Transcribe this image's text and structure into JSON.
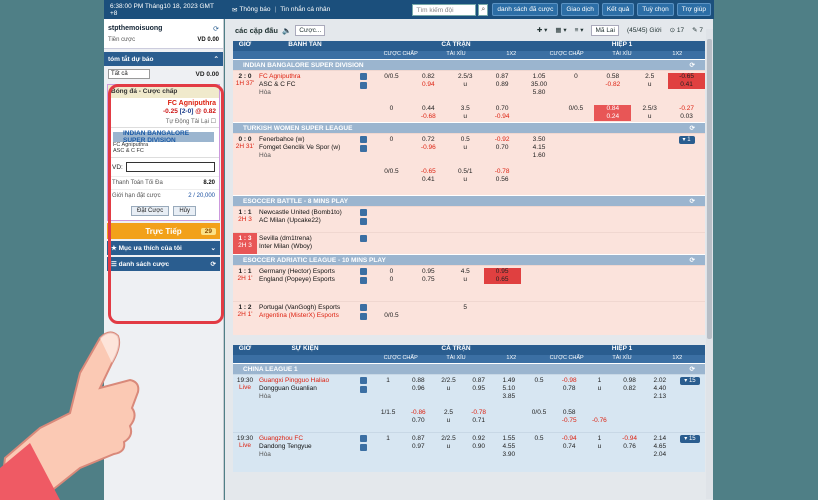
{
  "topbar": {
    "datetime": "6:38:00 PM Tháng10 18, 2023 GMT +8",
    "notice": "Thông báo",
    "inbox": "Tin nhắn cá nhân",
    "search_placeholder": "Tìm kiếm đội",
    "buttons": [
      "danh sách đã cược",
      "Giao dịch",
      "Kết quả",
      "Tuỳ chọn",
      "Trợ giúp"
    ]
  },
  "account": {
    "username": "stpthemoisuong",
    "credit_label": "Tiền cược",
    "credit_value": "VD 0.00",
    "summary_title": "tóm tắt dự báo",
    "filter": "Tất cả",
    "filter_value": "VD 0.00"
  },
  "slip": {
    "header": "Bóng đá - Cược chấp",
    "team": "FC Agniputhra",
    "odds_line": "-0.25",
    "score": "[2-0]",
    "odds": "0.82",
    "auto_accept": "Tự Động Tải Lại",
    "league": "INDIAN BANGALORE SUPER DIVISION",
    "home": "FC Agniputhra",
    "away": "ASC & C FC",
    "vd_label": "VD:",
    "max_payout_label": "Thanh Toán Tối Đa",
    "max_payout_value": "8.20",
    "bet_limit_label": "Giới hạn đặt cược",
    "bet_limit_value": "2 / 20,000",
    "place_bet": "Đặt Cược",
    "cancel": "Hủy"
  },
  "live": {
    "label": "Trực Tiếp",
    "count": "29"
  },
  "favorites": "Mục ưa thích của tôi",
  "bet_list": "danh sách cược",
  "main": {
    "title": "các cặp đấu",
    "mode": "Cược...",
    "sort": "Mã Lai",
    "count": "(45/45) Giới",
    "num": "17",
    "seven": "7"
  },
  "table_head": {
    "gio": "GIỜ",
    "banh_tan": "BANH TAN",
    "su_kien": "SỰ KIỆN",
    "ca_tran": "CẢ TRẬN",
    "hiep1": "HIỆP 1",
    "sub": [
      "CƯỢC CHẤP",
      "TÀI XỈU",
      "1X2",
      "CƯỢC CHẤP",
      "TÀI XỈU",
      "1X2"
    ]
  },
  "leagues": [
    {
      "name": "INDIAN BANGALORE SUPER DIVISION"
    },
    {
      "name": "TURKISH WOMEN SUPER LEAGUE"
    },
    {
      "name": "ESOCCER BATTLE - 8 MINS PLAY"
    },
    {
      "name": "ESOCCER ADRIATIC LEAGUE - 10 MINS PLAY"
    },
    {
      "name": "CHINA LEAGUE 1"
    }
  ],
  "matches": {
    "m1": {
      "score": "2 : 0",
      "time": "1H 37'",
      "home": "FC Agniputhra",
      "away": "ASC & C FC",
      "draw": "Hòa",
      "r1": [
        "0/0.5",
        "0.82",
        "2.5/3",
        "0.87",
        "1.05",
        "0",
        "0.58",
        "2.5",
        "-0.65"
      ],
      "r2": [
        "",
        "0.94",
        "u",
        "0.89",
        "35.00",
        "",
        "-0.82",
        "u",
        "0.41"
      ],
      "r3": [
        "",
        "",
        "",
        "",
        "5.80",
        "",
        "",
        "",
        ""
      ],
      "r4": [
        "0",
        "0.44",
        "3.5",
        "0.70",
        "",
        "0/0.5",
        "0.84",
        "2.5/3",
        "-0.27"
      ],
      "r5": [
        "",
        "-0.68",
        "u",
        "-0.94",
        "",
        "",
        "0.24",
        "u",
        "0.03"
      ]
    },
    "m2": {
      "score": "0 : 0",
      "time": "2H 31'",
      "home": "Fenerbahce (w)",
      "away": "Fomget Genclik Ve Spor (w)",
      "draw": "Hòa",
      "r1": [
        "0",
        "0.72",
        "0.5",
        "-0.92",
        "3.50"
      ],
      "r2": [
        "",
        "-0.96",
        "u",
        "0.70",
        "4.15"
      ],
      "r3": [
        "",
        "",
        "",
        "",
        "1.60"
      ],
      "r4": [
        "0/0.5",
        "-0.65",
        "0.5/1",
        "-0.78",
        ""
      ],
      "r5": [
        "",
        "0.41",
        "u",
        "0.56",
        ""
      ],
      "pill": "1"
    },
    "m3": {
      "score": "1 : 1",
      "time": "2H 3",
      "home": "Newcastle United (Bomb1to)",
      "away": "AC Milan (Upcake22)"
    },
    "m4": {
      "score": "1 : 3",
      "time": "2H 3",
      "home": "Sevilla (dm1trena)",
      "away": "Inter Milan (Wboy)"
    },
    "m5": {
      "score": "1 : 1",
      "time": "2H 1'",
      "home": "Germany (Hector) Esports",
      "away": "England (Popeye) Esports",
      "r1": [
        "0",
        "0.95",
        "4.5",
        "0.95"
      ],
      "r2": [
        "0",
        "0.75",
        "u",
        "0.65"
      ]
    },
    "m6": {
      "score": "1 : 2",
      "time": "2H 1'",
      "home": "Portugal (VanGogh) Esports",
      "away": "Argentina (MisterX) Esports",
      "r1": [
        "5"
      ],
      "r2": [
        "0/0.5"
      ]
    },
    "m7": {
      "time": "19:30",
      "live": "Live",
      "home": "Guangxi Pingguo Haliao",
      "away": "Dongguan Guanlian",
      "draw": "Hòa",
      "r1": [
        "1",
        "0.88",
        "2/2.5",
        "0.87",
        "1.49",
        "0.5",
        "-0.98",
        "1",
        "0.98",
        "2.02"
      ],
      "r2": [
        "",
        "0.96",
        "u",
        "0.95",
        "5.10",
        "",
        "0.78",
        "u",
        "0.82",
        "4.40"
      ],
      "r3": [
        "",
        "",
        "",
        "",
        "3.85",
        "",
        "",
        "",
        "",
        "2.13"
      ],
      "r4": [
        "1/1.5",
        "-0.86",
        "2.5",
        "-0.78",
        "",
        "0/0.5",
        "0.58",
        "",
        "",
        ""
      ],
      "r5": [
        "",
        "0.70",
        "u",
        "0.71",
        "",
        "",
        "-0.75",
        "-0.76",
        "",
        ""
      ],
      "pill": "15"
    },
    "m8": {
      "time": "19:30",
      "live": "Live",
      "home": "Guangzhou FC",
      "away": "Dandong Tengyue",
      "draw": "Hòa",
      "r1": [
        "1",
        "0.87",
        "2/2.5",
        "0.92",
        "1.55",
        "0.5",
        "-0.94",
        "1",
        "-0.94",
        "2.14"
      ],
      "r2": [
        "",
        "0.97",
        "u",
        "0.90",
        "4.55",
        "",
        "0.74",
        "u",
        "0.76",
        "4.65"
      ],
      "r3": [
        "",
        "",
        "",
        "",
        "3.90",
        "",
        "",
        "",
        "",
        "2.04"
      ],
      "r4": [
        "0.5/1",
        "-0.86",
        "2.5",
        "-0.87",
        "",
        "",
        "",
        "",
        "",
        ""
      ],
      "pill": "15"
    }
  },
  "colors": {
    "accent": "#2a5d8f",
    "highlight": "#e04040",
    "circle": "#e23b44"
  }
}
